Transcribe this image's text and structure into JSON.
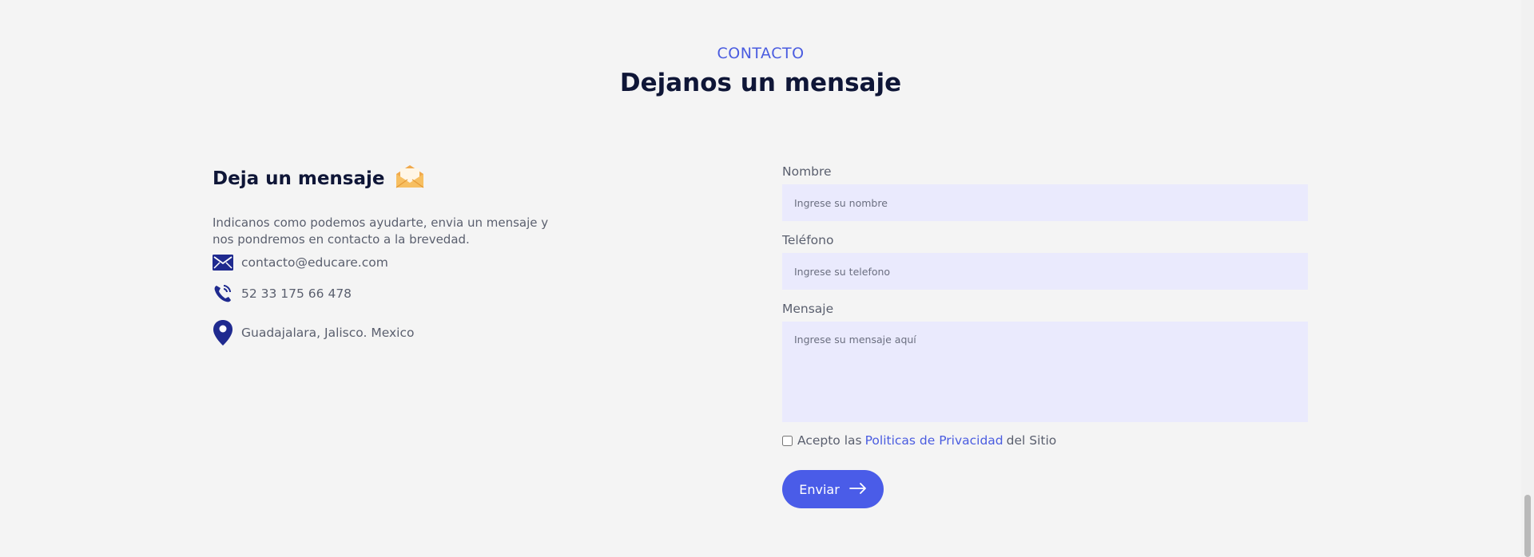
{
  "section": {
    "eyebrow": "CONTACTO",
    "title": "Dejanos un mensaje"
  },
  "info": {
    "title": "Deja un mensaje",
    "title_icon": "envelope-open-icon",
    "description": "Indicanos como podemos ayudarte, envia un mensaje y nos pondremos en contacto a la brevedad.",
    "email": "contacto@educare.com",
    "phone": "52 33 175 66 478",
    "location": "Guadajalara, Jalisco. Mexico"
  },
  "form": {
    "name_label": "Nombre",
    "name_placeholder": "Ingrese su nombre",
    "phone_label": "Teléfono",
    "phone_placeholder": "Ingrese su telefono",
    "message_label": "Mensaje",
    "message_placeholder": "Ingrese su mensaje aquí",
    "consent_prefix": "Acepto las",
    "consent_link": "Politicas de Privacidad",
    "consent_suffix": "del Sitio",
    "submit_label": "Enviar"
  },
  "colors": {
    "accent": "#4a5ce8",
    "heading": "#0f1637",
    "input_bg": "#eaeafd",
    "icon": "#1f2a8f"
  }
}
